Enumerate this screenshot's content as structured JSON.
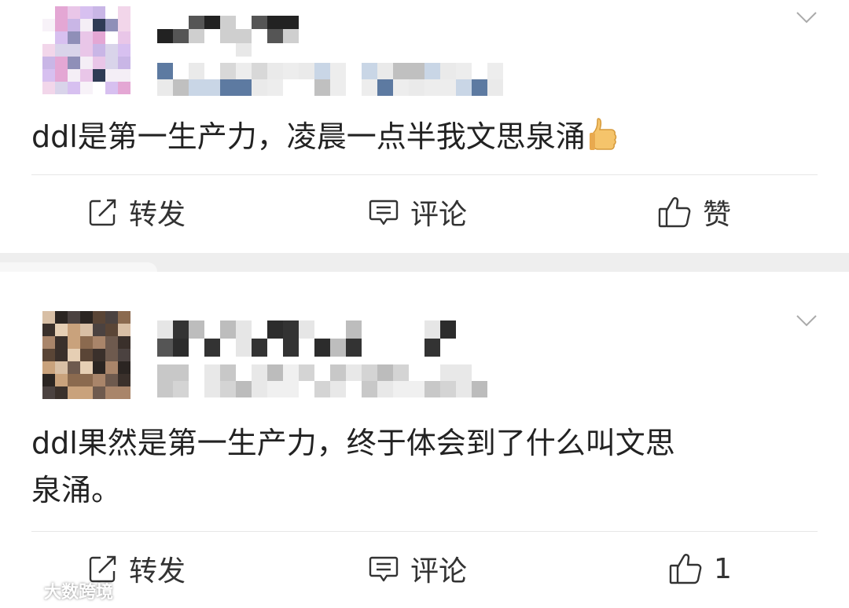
{
  "posts": [
    {
      "text": "ddl是第一生产力，凌晨一点半我文思泉涌",
      "emoji": "thumbs-up",
      "actions": {
        "repost": "转发",
        "comment": "评论",
        "like": "赞"
      }
    },
    {
      "text_line1": "ddl果然是第一生产力，终于体会到了什么叫文思",
      "text_line2": "泉涌。",
      "actions": {
        "repost": "转发",
        "comment": "评论",
        "like": "1"
      }
    }
  ],
  "watermark": {
    "text": "大数跨境"
  },
  "icons": [
    "chevron-down-icon",
    "repost-icon",
    "comment-icon",
    "like-icon",
    "thumbs-up-emoji-icon",
    "watermark-logo-icon"
  ],
  "colors": {
    "text": "#222222",
    "divider": "#e6e6e6",
    "separator": "#eeeeee",
    "icon": "#333333"
  }
}
